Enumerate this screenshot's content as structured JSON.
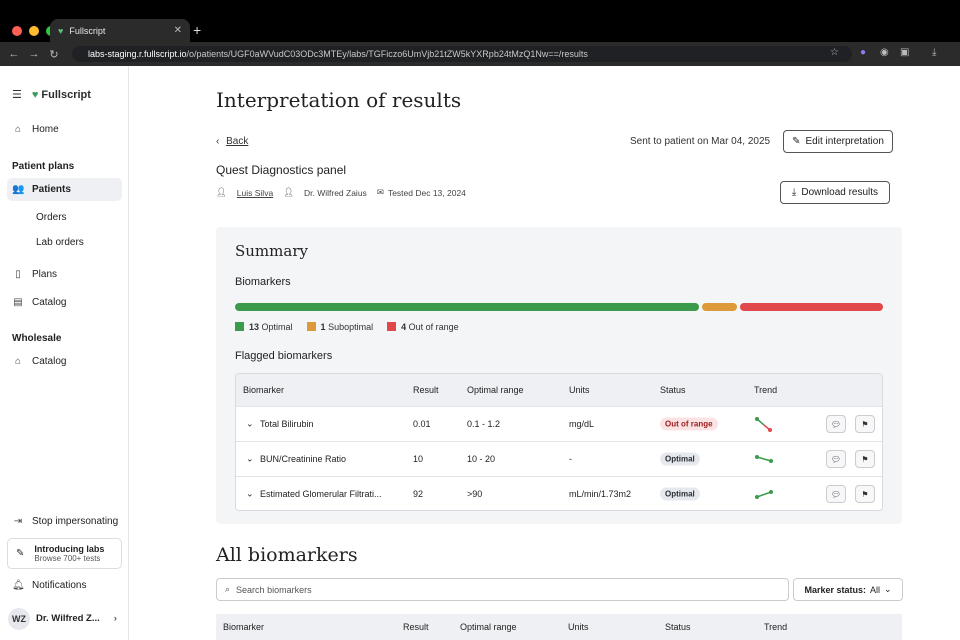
{
  "browser": {
    "tab_title": "Fullscript",
    "url_host": "labs-staging.r.fullscript.io",
    "url_path": "/o/patients/UGF0aWVudC03ODc3MTEy/labs/TGFiczo6UmVjb21tZW5kYXRpb24tMzQ1Nw==/results"
  },
  "sidebar": {
    "brand": "Fullscript",
    "home": "Home",
    "patient_plans_heading": "Patient plans",
    "patients": "Patients",
    "orders": "Orders",
    "lab_orders": "Lab orders",
    "plans": "Plans",
    "catalog": "Catalog",
    "wholesale_heading": "Wholesale",
    "wholesale_catalog": "Catalog",
    "stop_impersonating": "Stop impersonating",
    "promo_title": "Introducing labs",
    "promo_sub": "Browse 700+ tests",
    "notifications": "Notifications",
    "user_initials": "WZ",
    "user_name": "Dr. Wilfred Z..."
  },
  "page": {
    "title": "Interpretation of results",
    "back": "Back",
    "sent": "Sent to patient on Mar 04, 2025",
    "edit_button": "Edit interpretation",
    "panel_name": "Quest Diagnostics panel",
    "patient": "Luis Silva",
    "practitioner": "Dr. Wilfred Zaius",
    "tested": "Tested Dec 13, 2024",
    "download_button": "Download results"
  },
  "summary": {
    "title": "Summary",
    "biomarkers_label": "Biomarkers",
    "counts": {
      "optimal": 13,
      "suboptimal": 1,
      "out_of_range": 4
    },
    "legend": {
      "optimal": "Optimal",
      "suboptimal": "Suboptimal",
      "out_of_range": "Out of range"
    },
    "colors": {
      "optimal": "#3c9a4c",
      "suboptimal": "#de9a3a",
      "out_of_range": "#e0484c"
    },
    "flagged_label": "Flagged biomarkers",
    "columns": [
      "Biomarker",
      "Result",
      "Optimal range",
      "Units",
      "Status",
      "Trend"
    ],
    "rows": [
      {
        "name": "Total Bilirubin",
        "result": "0.01",
        "range": "0.1 - 1.2",
        "units": "mg/dL",
        "status": "Out of range"
      },
      {
        "name": "BUN/Creatinine Ratio",
        "result": "10",
        "range": "10 - 20",
        "units": "-",
        "status": "Optimal"
      },
      {
        "name": "Estimated Glomerular Filtrati...",
        "result": "92",
        "range": ">90",
        "units": "mL/min/1.73m2",
        "status": "Optimal"
      }
    ]
  },
  "all_biomarkers": {
    "title": "All biomarkers",
    "search_placeholder": "Search biomarkers",
    "marker_status_label": "Marker status:",
    "marker_status_value": "All",
    "columns": [
      "Biomarker",
      "Result",
      "Optimal range",
      "Units",
      "Status",
      "Trend"
    ]
  }
}
